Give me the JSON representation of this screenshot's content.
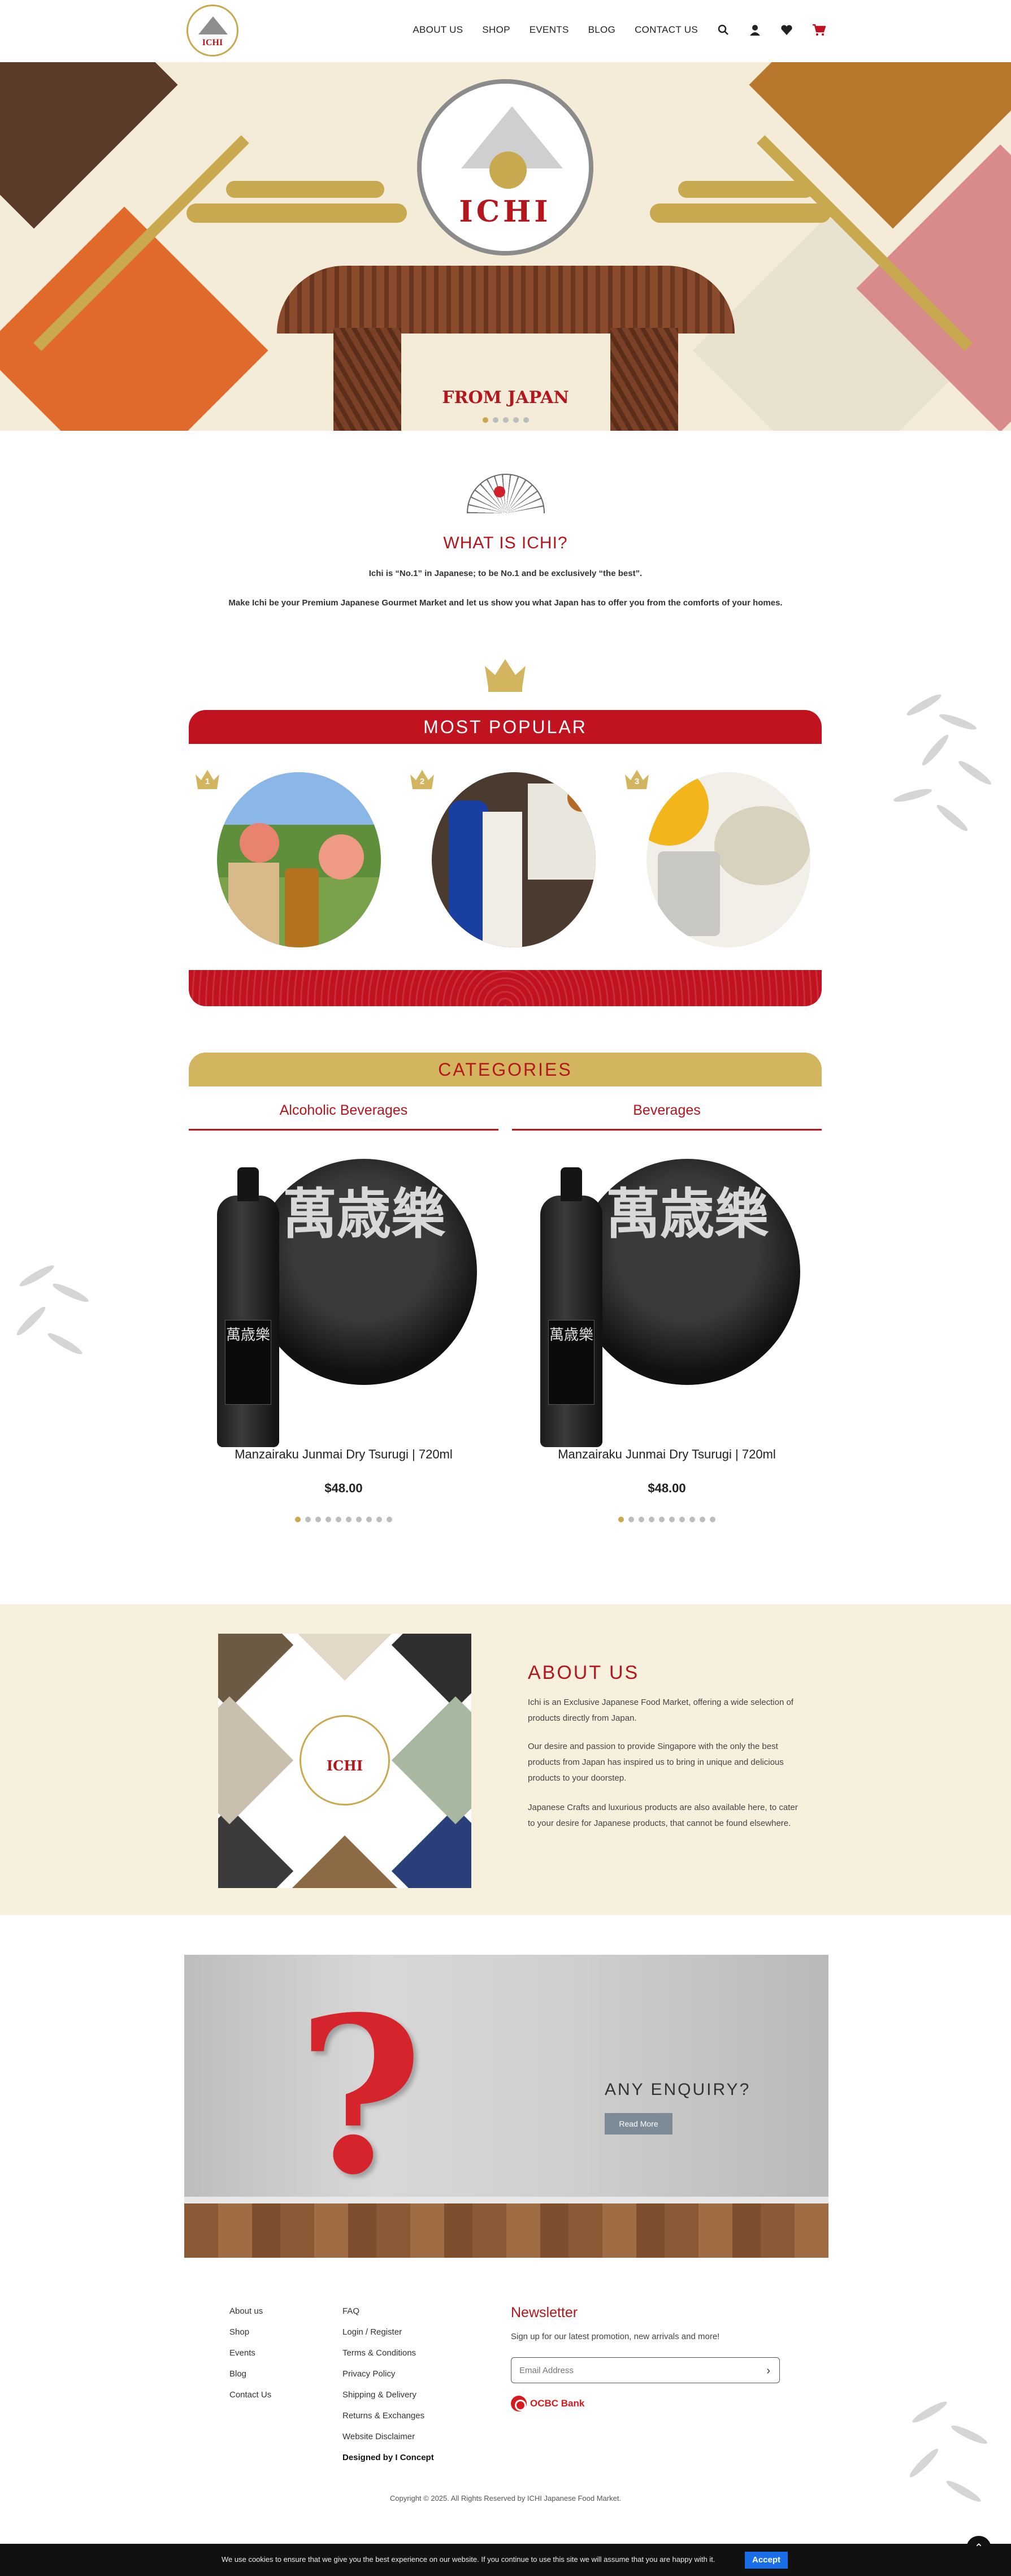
{
  "header": {
    "logo_text": "ICHI",
    "nav": [
      "ABOUT US",
      "SHOP",
      "EVENTS",
      "BLOG",
      "CONTACT US"
    ],
    "icons": [
      "search-icon",
      "user-icon",
      "heart-icon",
      "cart-icon"
    ]
  },
  "hero": {
    "brand": "ICHI",
    "title": "FROM JAPAN",
    "slide_count": 5,
    "active_slide": 1
  },
  "what": {
    "title": "WHAT IS ICHI?",
    "line1": "Ichi is “No.1” in Japanese; to be No.1 and be exclusively “the best”.",
    "line2": "Make Ichi be your Premium Japanese Gourmet Market and let us show you what Japan has to offer you from the comforts of your homes."
  },
  "popular": {
    "title": "MOST POPULAR",
    "ranks": [
      "1",
      "2",
      "3"
    ]
  },
  "categories": {
    "title": "CATEGORIES",
    "tabs": [
      "Alcoholic Beverages",
      "Beverages"
    ],
    "products": [
      {
        "name": "Manzairaku Junmai Dry Tsurugi | 720ml",
        "price": "$48.00",
        "kanji": "萬歳樂"
      },
      {
        "name": "Manzairaku Junmai Dry Tsurugi | 720ml",
        "price": "$48.00",
        "kanji": "萬歳樂"
      }
    ]
  },
  "about": {
    "title": "ABOUT US",
    "p1": "Ichi is an Exclusive Japanese Food Market, offering a wide selection of products directly from Japan.",
    "p2": "Our desire and passion to provide Singapore with the only the best products from Japan has inspired us to bring in unique and delicious products to your doorstep.",
    "p3": "Japanese Crafts and luxurious products are also available here, to cater to your desire for Japanese products, that cannot be found elsewhere.",
    "collage_logo": "ICHI"
  },
  "enquiry": {
    "title": "ANY ENQUIRY?",
    "button": "Read More"
  },
  "footer": {
    "col1": [
      "About us",
      "Shop",
      "Events",
      "Blog",
      "Contact Us"
    ],
    "col2": [
      "FAQ",
      "Login / Register",
      "Terms & Conditions",
      "Privacy Policy",
      "Shipping & Delivery",
      "Returns & Exchanges",
      "Website Disclaimer"
    ],
    "designed": "Designed by I Concept",
    "newsletter_title": "Newsletter",
    "newsletter_sub": "Sign up for our latest promotion, new arrivals and more!",
    "email_placeholder": "Email Address",
    "bank": "OCBC Bank",
    "copyright": "Copyright © 2025. All Rights Reserved by ICHI Japanese Food Market."
  },
  "cookie": {
    "message": "We use cookies to ensure that we give you the best experience on our website. If you continue to use this site we will assume that you are happy with it.",
    "accept": "Accept"
  },
  "colors": {
    "accent_red": "#b3171d",
    "gold": "#c9a94f",
    "cream": "#f7f0dc"
  }
}
